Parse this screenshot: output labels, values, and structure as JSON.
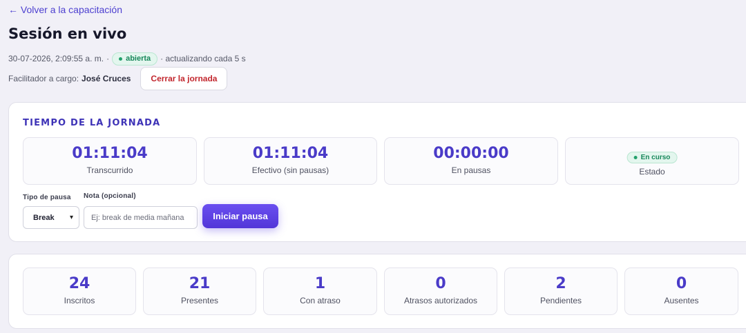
{
  "nav": {
    "back_label": "← Volver a la capacitación"
  },
  "page": {
    "title": "Sesión en vivo"
  },
  "meta": {
    "datetime": "30-07-2026, 2:09:55 a. m.",
    "separator": "·",
    "status_badge": "abierta",
    "refresh_text": "· actualizando cada 5 s"
  },
  "facilitator": {
    "label": "Facilitador a cargo:",
    "name": "José Cruces",
    "close_button": "Cerrar la jornada"
  },
  "timer": {
    "title": "TIEMPO DE LA JORNADA",
    "boxes": [
      {
        "value": "01:11:04",
        "label": "Transcurrido"
      },
      {
        "value": "01:11:04",
        "label": "Efectivo (sin pausas)"
      },
      {
        "value": "00:00:00",
        "label": "En pausas"
      }
    ],
    "status": {
      "badge": "En curso",
      "label": "Estado"
    },
    "pause_type": {
      "label": "Tipo de pausa",
      "value": "Break"
    },
    "note": {
      "label": "Nota (opcional)",
      "placeholder": "Ej: break de media mañana"
    },
    "start_pause_button": "Iniciar pausa"
  },
  "stats": [
    {
      "value": "24",
      "label": "Inscritos"
    },
    {
      "value": "21",
      "label": "Presentes"
    },
    {
      "value": "1",
      "label": "Con atraso"
    },
    {
      "value": "0",
      "label": "Atrasos autorizados"
    },
    {
      "value": "2",
      "label": "Pendientes"
    },
    {
      "value": "0",
      "label": "Ausentes"
    }
  ],
  "colors": {
    "accent": "#4a3bc8",
    "success": "#17875a",
    "danger": "#c2262d",
    "background": "#f1f0f7"
  }
}
